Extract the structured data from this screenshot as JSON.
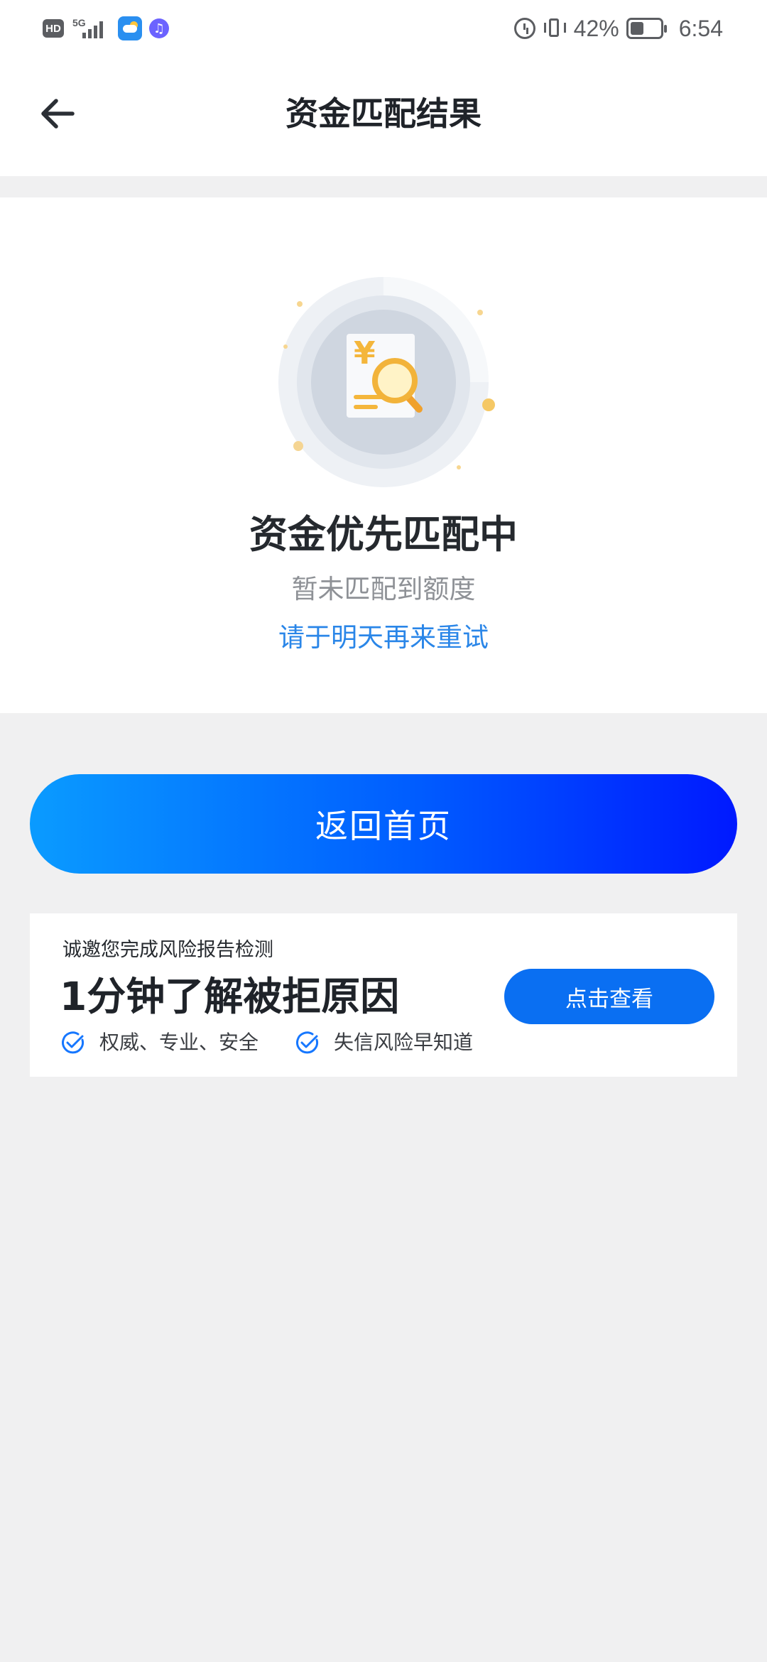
{
  "status_bar": {
    "hd": "HD",
    "network": "5G",
    "battery_percent": "42%",
    "time": "6:54"
  },
  "nav": {
    "title": "资金匹配结果"
  },
  "result": {
    "title": "资金优先匹配中",
    "subtitle": "暂未匹配到额度",
    "tip": "请于明天再来重试",
    "illustration_symbol": "¥"
  },
  "actions": {
    "home_label": "返回首页"
  },
  "promo": {
    "invite": "诚邀您完成风险报告检测",
    "headline": "1分钟了解被拒原因",
    "features": [
      "权威、专业、安全",
      "失信风险早知道"
    ],
    "button_label": "点击查看"
  },
  "colors": {
    "accent": "#0a6ff2",
    "tip_text": "#2a86e8",
    "gradient_start": "#0a9bff",
    "gradient_end": "#0019ff"
  },
  "icons": {
    "back": "arrow-left-icon",
    "check": "check-circle-icon"
  }
}
